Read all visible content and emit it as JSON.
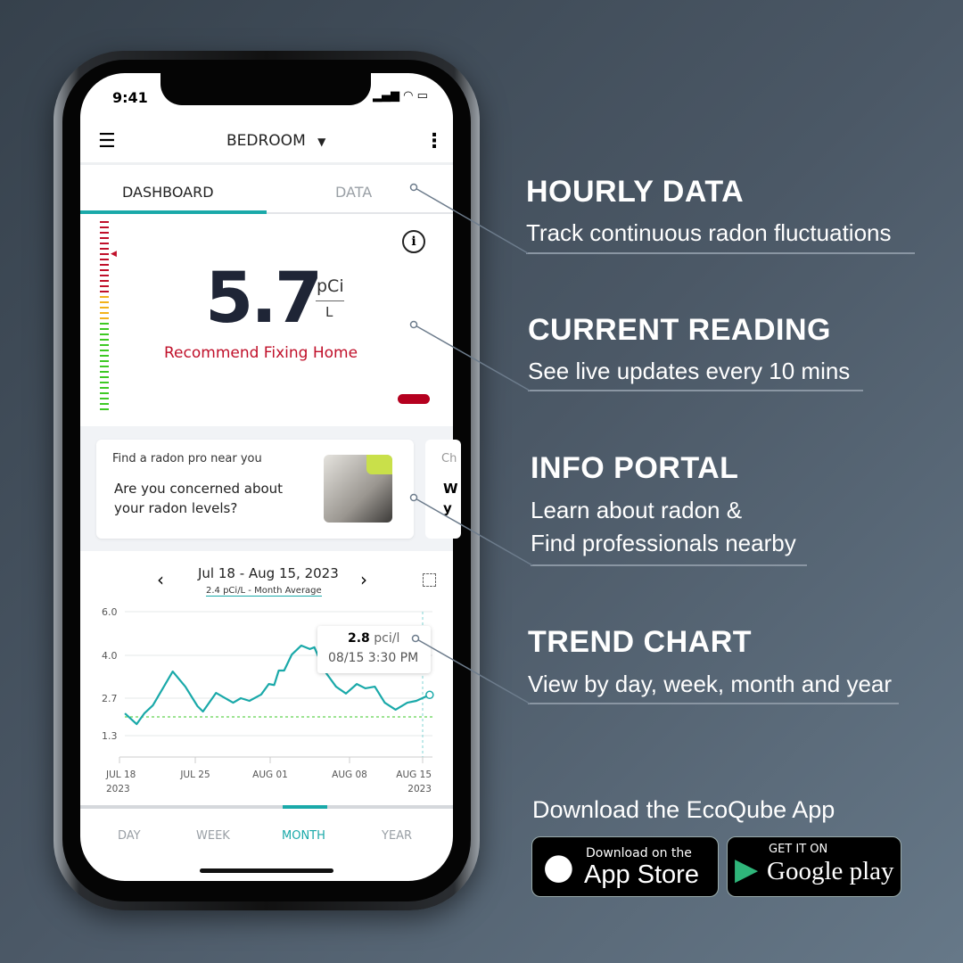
{
  "status_bar": {
    "time": "9:41"
  },
  "header": {
    "room": "BEDROOM"
  },
  "tabs": [
    {
      "label": "DASHBOARD",
      "active": true
    },
    {
      "label": "DATA",
      "active": false
    }
  ],
  "reading": {
    "value": "5.7",
    "unit_top": "pCi",
    "unit_bottom": "L",
    "status": "Recommend Fixing Home",
    "status_color": "#c0102a"
  },
  "cards": [
    {
      "subtitle": "Find a radon pro near you",
      "title": "Are you concerned about your radon levels?"
    },
    {
      "subtitle": "Ch",
      "title": "W y"
    }
  ],
  "chart_header": {
    "range": "Jul 18 - Aug 15, 2023",
    "average": "2.4 pCi/L - Month Average"
  },
  "tooltip": {
    "value": "2.8",
    "unit": "pci/l",
    "time": "08/15 3:30 PM"
  },
  "period_tabs": [
    {
      "label": "DAY"
    },
    {
      "label": "WEEK"
    },
    {
      "label": "MONTH",
      "active": true
    },
    {
      "label": "YEAR"
    }
  ],
  "chart_data": {
    "type": "line",
    "y_ticks": [
      "6.0",
      "4.0",
      "2.7",
      "1.3"
    ],
    "x_ticks": [
      {
        "label": "JUL 18",
        "sub": "2023"
      },
      {
        "label": "JUL 25",
        "sub": ""
      },
      {
        "label": "AUG 01",
        "sub": ""
      },
      {
        "label": "AUG 08",
        "sub": ""
      },
      {
        "label": "AUG 15",
        "sub": "2023"
      }
    ],
    "x": [
      "2023-07-18T12:00",
      "2023-07-19T14:00",
      "2023-07-20T07:00",
      "2023-07-21T02:00",
      "2023-07-22T22:00",
      "2023-07-24T02:00",
      "2023-07-25T05:00",
      "2023-07-25T17:00",
      "2023-07-26T22:00",
      "2023-07-28T12:00",
      "2023-07-29T05:00",
      "2023-07-30T00:00",
      "2023-07-31T02:00",
      "2023-07-31T19:00",
      "2023-08-01T07:00",
      "2023-08-01T17:00",
      "2023-08-02T05:00",
      "2023-08-02T22:00",
      "2023-08-03T19:00",
      "2023-08-04T14:00",
      "2023-08-05T00:00",
      "2023-08-05T22:00",
      "2023-08-07T00:00",
      "2023-08-07T22:00",
      "2023-08-08T22:00",
      "2023-08-09T17:00",
      "2023-08-10T14:00",
      "2023-08-11T12:00",
      "2023-08-12T12:00",
      "2023-08-13T14:00",
      "2023-08-14T10:00",
      "2023-08-15T15:30"
    ],
    "values": [
      2.13,
      1.73,
      2.13,
      2.43,
      3.51,
      3.05,
      2.4,
      2.2,
      2.86,
      2.53,
      2.7,
      2.6,
      2.81,
      3.13,
      3.1,
      3.54,
      3.54,
      4.04,
      4.45,
      4.29,
      4.37,
      3.54,
      3.05,
      2.84,
      3.13,
      3.0,
      3.05,
      2.53,
      2.27,
      2.53,
      2.6,
      2.8
    ],
    "average": 2.4,
    "line_color": "#1aa9a9",
    "average_color": "#7ddc6e"
  },
  "annotations": [
    {
      "title": "HOURLY DATA",
      "text": "Track continuous radon fluctuations"
    },
    {
      "title": "CURRENT READING",
      "text": "See live updates every 10 mins"
    },
    {
      "title": "INFO PORTAL",
      "text": "Learn about radon &",
      "text2": "Find professionals nearby"
    },
    {
      "title": "TREND CHART",
      "text": "View by day, week, month and year"
    }
  ],
  "download": {
    "heading": "Download the EcoQube App",
    "app_store_small": "Download on the",
    "app_store_big": "App Store",
    "google_small": "GET IT ON",
    "google_big": "Google play"
  }
}
